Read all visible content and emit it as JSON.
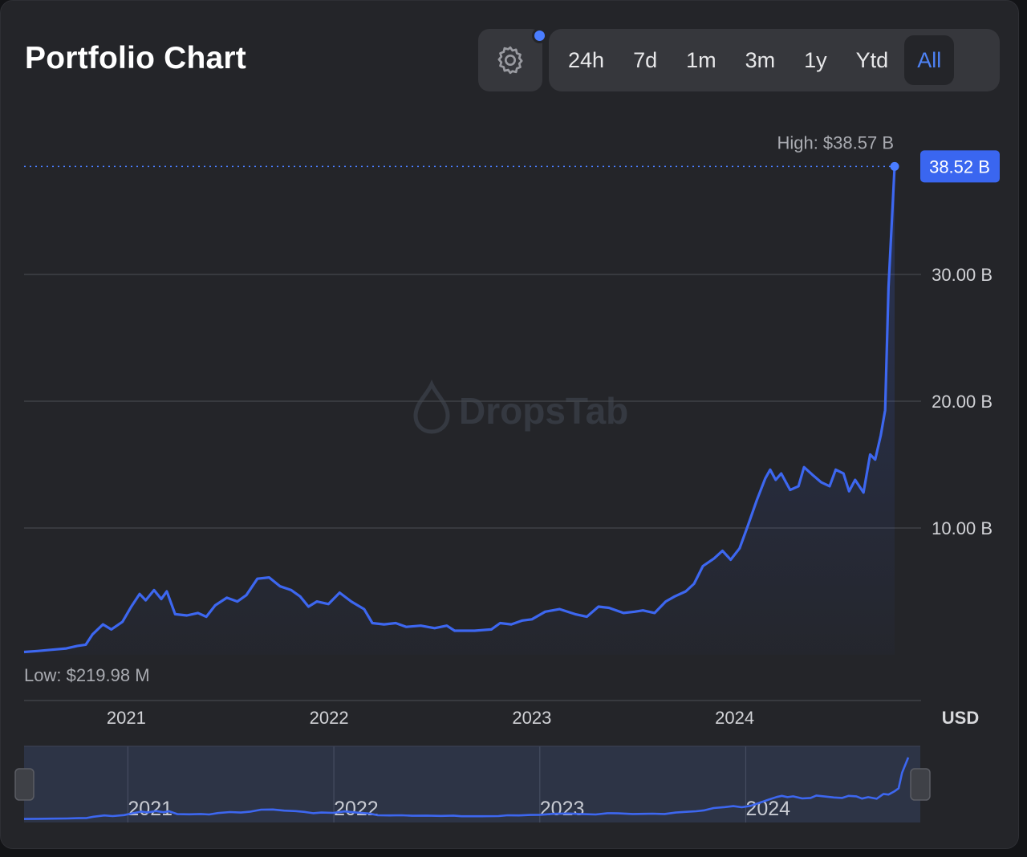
{
  "title": "Portfolio Chart",
  "settings": {
    "icon": "gear-icon",
    "indicator_color": "#4a7dff"
  },
  "ranges": [
    {
      "label": "24h",
      "active": false
    },
    {
      "label": "7d",
      "active": false
    },
    {
      "label": "1m",
      "active": false
    },
    {
      "label": "3m",
      "active": false
    },
    {
      "label": "1y",
      "active": false
    },
    {
      "label": "Ytd",
      "active": false
    },
    {
      "label": "All",
      "active": true
    }
  ],
  "watermark": "DropsTab",
  "colors": {
    "line": "#3d67f0",
    "accent": "#4a7dff",
    "current_badge": "#3a66f0"
  },
  "chart_data": {
    "type": "area",
    "currency": "USD",
    "unit": "B",
    "x_range": [
      "2020-07-01",
      "2024-10-15"
    ],
    "ylim": [
      0,
      40
    ],
    "yticks": [
      {
        "value": 10,
        "label": "10.00 B"
      },
      {
        "value": 20,
        "label": "20.00 B"
      },
      {
        "value": 30,
        "label": "30.00 B"
      }
    ],
    "xticks": [
      {
        "date": "2021-01-01",
        "label": "2021"
      },
      {
        "date": "2022-01-01",
        "label": "2022"
      },
      {
        "date": "2023-01-01",
        "label": "2023"
      },
      {
        "date": "2024-01-01",
        "label": "2024"
      }
    ],
    "high_label": "High: $38.57 B",
    "low_label": "Low: $219.98 M",
    "current": {
      "date": "2024-10-15",
      "value": 38.52,
      "label": "38.52 B"
    },
    "series": [
      {
        "points": [
          [
            "2020-07-01",
            0.22
          ],
          [
            "2020-07-25",
            0.3
          ],
          [
            "2020-08-20",
            0.4
          ],
          [
            "2020-09-15",
            0.5
          ],
          [
            "2020-10-05",
            0.7
          ],
          [
            "2020-10-20",
            0.8
          ],
          [
            "2020-11-01",
            1.6
          ],
          [
            "2020-11-20",
            2.4
          ],
          [
            "2020-12-05",
            2.0
          ],
          [
            "2020-12-25",
            2.6
          ],
          [
            "2021-01-10",
            3.8
          ],
          [
            "2021-01-25",
            4.8
          ],
          [
            "2021-02-05",
            4.3
          ],
          [
            "2021-02-20",
            5.1
          ],
          [
            "2021-03-05",
            4.4
          ],
          [
            "2021-03-15",
            5.0
          ],
          [
            "2021-03-30",
            3.2
          ],
          [
            "2021-04-20",
            3.1
          ],
          [
            "2021-05-10",
            3.3
          ],
          [
            "2021-05-25",
            3.0
          ],
          [
            "2021-06-10",
            3.9
          ],
          [
            "2021-07-01",
            4.5
          ],
          [
            "2021-07-20",
            4.2
          ],
          [
            "2021-08-05",
            4.7
          ],
          [
            "2021-08-25",
            6.0
          ],
          [
            "2021-09-15",
            6.1
          ],
          [
            "2021-10-05",
            5.4
          ],
          [
            "2021-10-25",
            5.1
          ],
          [
            "2021-11-10",
            4.6
          ],
          [
            "2021-11-25",
            3.8
          ],
          [
            "2021-12-10",
            4.2
          ],
          [
            "2021-12-31",
            4.0
          ],
          [
            "2022-01-20",
            4.9
          ],
          [
            "2022-02-10",
            4.2
          ],
          [
            "2022-03-05",
            3.6
          ],
          [
            "2022-03-20",
            2.5
          ],
          [
            "2022-04-10",
            2.4
          ],
          [
            "2022-05-01",
            2.5
          ],
          [
            "2022-05-20",
            2.2
          ],
          [
            "2022-06-15",
            2.3
          ],
          [
            "2022-07-10",
            2.1
          ],
          [
            "2022-08-01",
            2.3
          ],
          [
            "2022-08-15",
            1.9
          ],
          [
            "2022-09-20",
            1.9
          ],
          [
            "2022-10-20",
            2.0
          ],
          [
            "2022-11-05",
            2.5
          ],
          [
            "2022-11-25",
            2.4
          ],
          [
            "2022-12-15",
            2.7
          ],
          [
            "2023-01-01",
            2.8
          ],
          [
            "2023-01-25",
            3.4
          ],
          [
            "2023-02-20",
            3.6
          ],
          [
            "2023-03-20",
            3.2
          ],
          [
            "2023-04-10",
            3.0
          ],
          [
            "2023-05-01",
            3.8
          ],
          [
            "2023-05-20",
            3.7
          ],
          [
            "2023-06-15",
            3.3
          ],
          [
            "2023-07-05",
            3.4
          ],
          [
            "2023-07-20",
            3.5
          ],
          [
            "2023-08-10",
            3.3
          ],
          [
            "2023-08-30",
            4.2
          ],
          [
            "2023-09-15",
            4.6
          ],
          [
            "2023-10-05",
            5.0
          ],
          [
            "2023-10-20",
            5.6
          ],
          [
            "2023-11-05",
            7.0
          ],
          [
            "2023-11-25",
            7.6
          ],
          [
            "2023-12-10",
            8.2
          ],
          [
            "2023-12-25",
            7.5
          ],
          [
            "2024-01-10",
            8.4
          ],
          [
            "2024-01-25",
            10.2
          ],
          [
            "2024-02-10",
            12.2
          ],
          [
            "2024-02-25",
            13.9
          ],
          [
            "2024-03-05",
            14.6
          ],
          [
            "2024-03-15",
            13.8
          ],
          [
            "2024-03-25",
            14.3
          ],
          [
            "2024-04-10",
            13.0
          ],
          [
            "2024-04-25",
            13.3
          ],
          [
            "2024-05-05",
            14.8
          ],
          [
            "2024-05-20",
            14.2
          ],
          [
            "2024-06-05",
            13.6
          ],
          [
            "2024-06-20",
            13.3
          ],
          [
            "2024-07-01",
            14.6
          ],
          [
            "2024-07-15",
            14.3
          ],
          [
            "2024-07-25",
            12.9
          ],
          [
            "2024-08-05",
            13.8
          ],
          [
            "2024-08-20",
            12.8
          ],
          [
            "2024-09-01",
            15.8
          ],
          [
            "2024-09-10",
            15.4
          ],
          [
            "2024-09-20",
            17.3
          ],
          [
            "2024-09-28",
            19.3
          ],
          [
            "2024-10-04",
            29.0
          ],
          [
            "2024-10-15",
            38.52
          ]
        ]
      }
    ],
    "navigator": {
      "xticks": [
        {
          "date": "2021-01-01",
          "label": "2021"
        },
        {
          "date": "2022-01-01",
          "label": "2022"
        },
        {
          "date": "2023-01-01",
          "label": "2023"
        },
        {
          "date": "2024-01-01",
          "label": "2024"
        }
      ]
    }
  }
}
